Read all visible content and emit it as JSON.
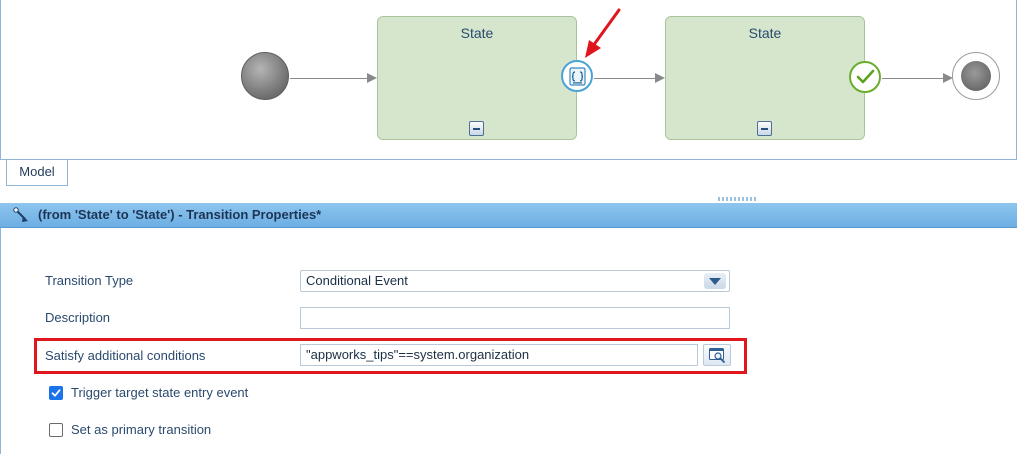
{
  "diagram": {
    "states": [
      {
        "title": "State"
      },
      {
        "title": "State"
      }
    ]
  },
  "tabs": {
    "model_label": "Model"
  },
  "panel": {
    "title": "(from 'State' to 'State') - Transition Properties*"
  },
  "form": {
    "transition_type": {
      "label": "Transition Type",
      "value": "Conditional Event"
    },
    "description": {
      "label": "Description",
      "value": ""
    },
    "conditions": {
      "label": "Satisfy additional conditions",
      "value": "\"appworks_tips\"==system.organization"
    },
    "trigger_entry": {
      "label": "Trigger target state entry event",
      "checked": true
    },
    "primary": {
      "label": "Set as primary transition",
      "checked": false
    }
  },
  "colors": {
    "accent": "#6caee3",
    "highlight": "#e0161e",
    "state_fill": "#d6e6cd",
    "check_green": "#6aad2d",
    "checkbox_blue": "#1a73e8"
  },
  "icons": {
    "condition": "condition-script-icon",
    "check": "check-circle-icon",
    "builder": "expression-builder-icon",
    "panel": "transition-icon"
  }
}
